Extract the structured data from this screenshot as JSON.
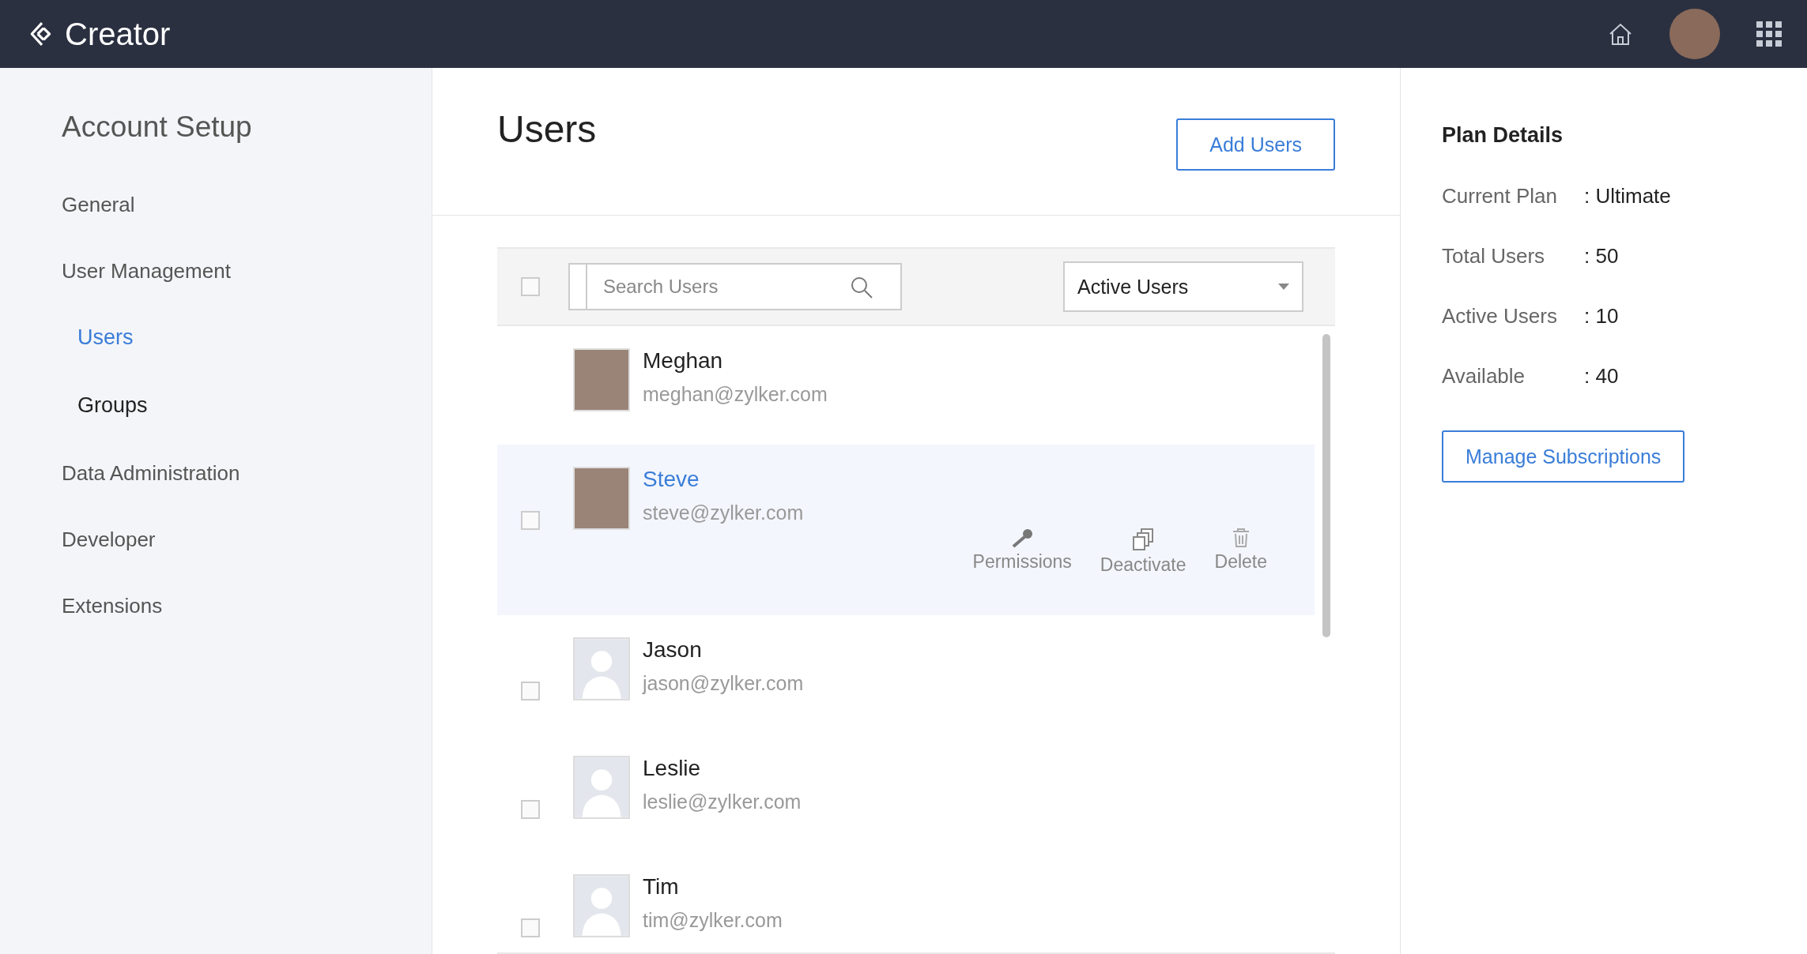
{
  "app": {
    "name": "Creator"
  },
  "sidebar": {
    "title": "Account Setup",
    "items": [
      {
        "label": "General",
        "selected": false
      },
      {
        "label": "User Management",
        "selected": false,
        "children": [
          {
            "label": "Users",
            "selected": true
          },
          {
            "label": "Groups",
            "selected": false
          }
        ]
      },
      {
        "label": "Data Administration",
        "selected": false
      },
      {
        "label": "Developer",
        "selected": false
      },
      {
        "label": "Extensions",
        "selected": false
      }
    ]
  },
  "main": {
    "title": "Users",
    "add_button": "Add Users",
    "search": {
      "placeholder": "Search Users"
    },
    "filter": {
      "value": "Active Users"
    },
    "select_all": {
      "checked": false
    },
    "users": [
      {
        "name": "Meghan",
        "email": "meghan@zylker.com",
        "kind": "photo",
        "selected": false
      },
      {
        "name": "Steve",
        "email": "steve@zylker.com",
        "kind": "photo",
        "checked": false,
        "selected": true,
        "actions": [
          {
            "kind": "key",
            "label": "Permissions"
          },
          {
            "kind": "copy",
            "label": "Deactivate"
          },
          {
            "kind": "trash",
            "label": "Delete"
          }
        ]
      },
      {
        "name": "Jason",
        "email": "jason@zylker.com",
        "kind": "placeholder",
        "checked": false,
        "selected": false
      },
      {
        "name": "Leslie",
        "email": "leslie@zylker.com",
        "kind": "placeholder",
        "checked": false,
        "selected": false
      },
      {
        "name": "Tim",
        "email": "tim@zylker.com",
        "kind": "placeholder",
        "checked": false,
        "selected": false
      }
    ]
  },
  "plan": {
    "title": "Plan Details",
    "rows": [
      {
        "label": "Current Plan",
        "value": ": Ultimate"
      },
      {
        "label": "Total Users",
        "value": ": 50"
      },
      {
        "label": "Active Users",
        "value": ": 10"
      },
      {
        "label": "Available",
        "value": ": 40"
      }
    ],
    "button": "Manage Subscriptions"
  }
}
